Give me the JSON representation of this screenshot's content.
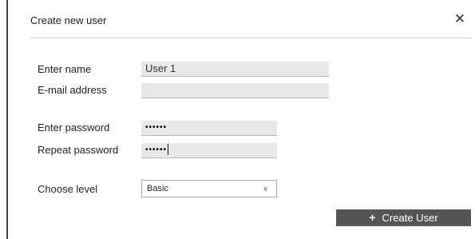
{
  "dialog": {
    "title": "Create new user",
    "close_icon": "close-icon",
    "close_glyph": "✕"
  },
  "form": {
    "name_label": "Enter name",
    "name_value": "User 1",
    "email_label": "E-mail address",
    "email_value": "",
    "password_label": "Enter password",
    "password_value": "••••••",
    "repeat_password_label": "Repeat password",
    "repeat_password_value": "••••••",
    "level_label": "Choose level",
    "level_value": "Basic",
    "level_chevron_icon": "chevron-down-icon"
  },
  "actions": {
    "create_label": "Create User",
    "create_icon": "plus-icon",
    "create_icon_glyph": "+",
    "button_color": "#555555"
  }
}
